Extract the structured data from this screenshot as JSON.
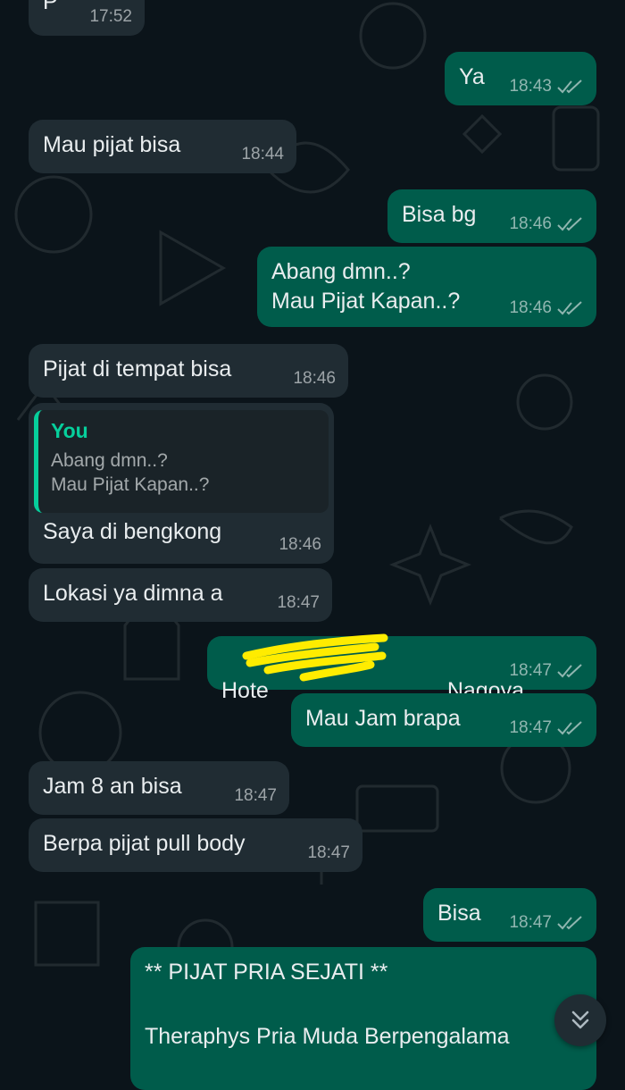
{
  "colors": {
    "background": "#0b141a",
    "incoming_bubble": "#202c33",
    "outgoing_bubble": "#005c4b",
    "quote_accent": "#06cf9c",
    "redaction_marker": "#ffec00"
  },
  "messages": [
    {
      "direction": "incoming",
      "text": "P",
      "time": "17:52"
    },
    {
      "direction": "outgoing",
      "text": "Ya",
      "time": "18:43",
      "status": "read"
    },
    {
      "direction": "incoming",
      "text": "Mau pijat bisa",
      "time": "18:44"
    },
    {
      "direction": "outgoing",
      "text": "Bisa bg",
      "time": "18:46",
      "status": "read"
    },
    {
      "direction": "outgoing",
      "text": "Abang dmn..?\nMau Pijat Kapan..?",
      "time": "18:46",
      "status": "read"
    },
    {
      "direction": "incoming",
      "text": "Pijat di tempat bisa",
      "time": "18:46"
    },
    {
      "direction": "incoming",
      "text": "Saya di bengkong",
      "time": "18:46",
      "reply_to": {
        "author": "You",
        "text": "Abang dmn..?\nMau Pijat Kapan..?"
      }
    },
    {
      "direction": "incoming",
      "text": "Lokasi ya dimna a",
      "time": "18:47"
    },
    {
      "direction": "outgoing",
      "text_start": "Hote",
      "text_end": "Nagoya",
      "redacted": true,
      "time": "18:47",
      "status": "read"
    },
    {
      "direction": "outgoing",
      "text": "Mau Jam brapa",
      "time": "18:47",
      "status": "read"
    },
    {
      "direction": "incoming",
      "text": "Jam 8 an bisa",
      "time": "18:47"
    },
    {
      "direction": "incoming",
      "text": "Berpa pijat pull body",
      "time": "18:47"
    },
    {
      "direction": "outgoing",
      "text": "Bisa",
      "time": "18:47",
      "status": "read"
    },
    {
      "direction": "outgoing",
      "text": "** PIJAT PRIA SEJATI **\n\nTheraphys Pria Muda Berpengalama"
    }
  ],
  "scroll_to_bottom_icon": "double-chevron-down-icon",
  "read_receipt_icon": "double-check-icon"
}
